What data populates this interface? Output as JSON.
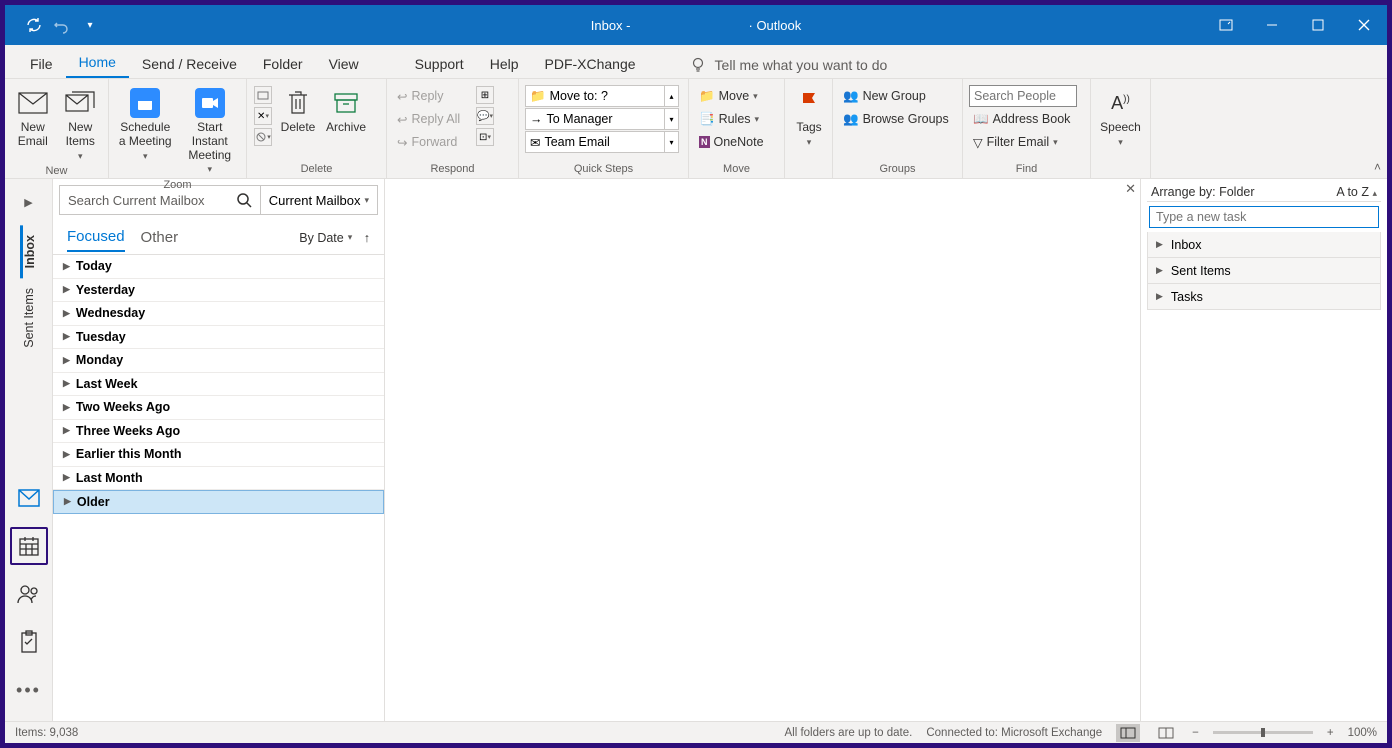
{
  "title": {
    "inbox": "Inbox -",
    "app": "· Outlook"
  },
  "tabs": [
    "File",
    "Home",
    "Send / Receive",
    "Folder",
    "View",
    "Support",
    "Help",
    "PDF-XChange"
  ],
  "activeTab": "Home",
  "tellMe": "Tell me what you want to do",
  "ribbon": {
    "new": {
      "label": "New",
      "email": "New Email",
      "items": "New Items"
    },
    "zoom": {
      "label": "Zoom",
      "schedule": "Schedule a Meeting",
      "instant": "Start Instant Meeting"
    },
    "delete": {
      "label": "Delete",
      "del": "Delete",
      "arch": "Archive"
    },
    "respond": {
      "label": "Respond",
      "reply": "Reply",
      "replyAll": "Reply All",
      "forward": "Forward"
    },
    "quick": {
      "label": "Quick Steps",
      "items": [
        "Move to: ?",
        "To Manager",
        "Team Email"
      ]
    },
    "move": {
      "label": "Move",
      "move": "Move",
      "rules": "Rules",
      "onenote": "OneNote"
    },
    "tags": {
      "label": "Tags",
      "tags": "Tags"
    },
    "groups": {
      "label": "Groups",
      "new": "New Group",
      "browse": "Browse Groups"
    },
    "find": {
      "label": "Find",
      "searchPlaceholder": "Search People",
      "address": "Address Book",
      "filter": "Filter Email"
    },
    "speech": {
      "label": "",
      "speech": "Speech"
    }
  },
  "folders": {
    "inbox": "Inbox",
    "sent": "Sent Items"
  },
  "search": {
    "placeholder": "Search Current Mailbox",
    "scope": "Current Mailbox"
  },
  "mailTabs": {
    "focused": "Focused",
    "other": "Other",
    "sort": "By Date"
  },
  "groupsList": [
    "Today",
    "Yesterday",
    "Wednesday",
    "Tuesday",
    "Monday",
    "Last Week",
    "Two Weeks Ago",
    "Three Weeks Ago",
    "Earlier this Month",
    "Last Month",
    "Older"
  ],
  "selectedGroup": "Older",
  "todo": {
    "arrange": "Arrange by: Folder",
    "order": "A to Z",
    "placeholder": "Type a new task",
    "items": [
      "Inbox",
      "Sent Items",
      "Tasks"
    ]
  },
  "status": {
    "items": "Items: 9,038",
    "sync": "All folders are up to date.",
    "conn": "Connected to: Microsoft Exchange",
    "zoom": "100%"
  }
}
